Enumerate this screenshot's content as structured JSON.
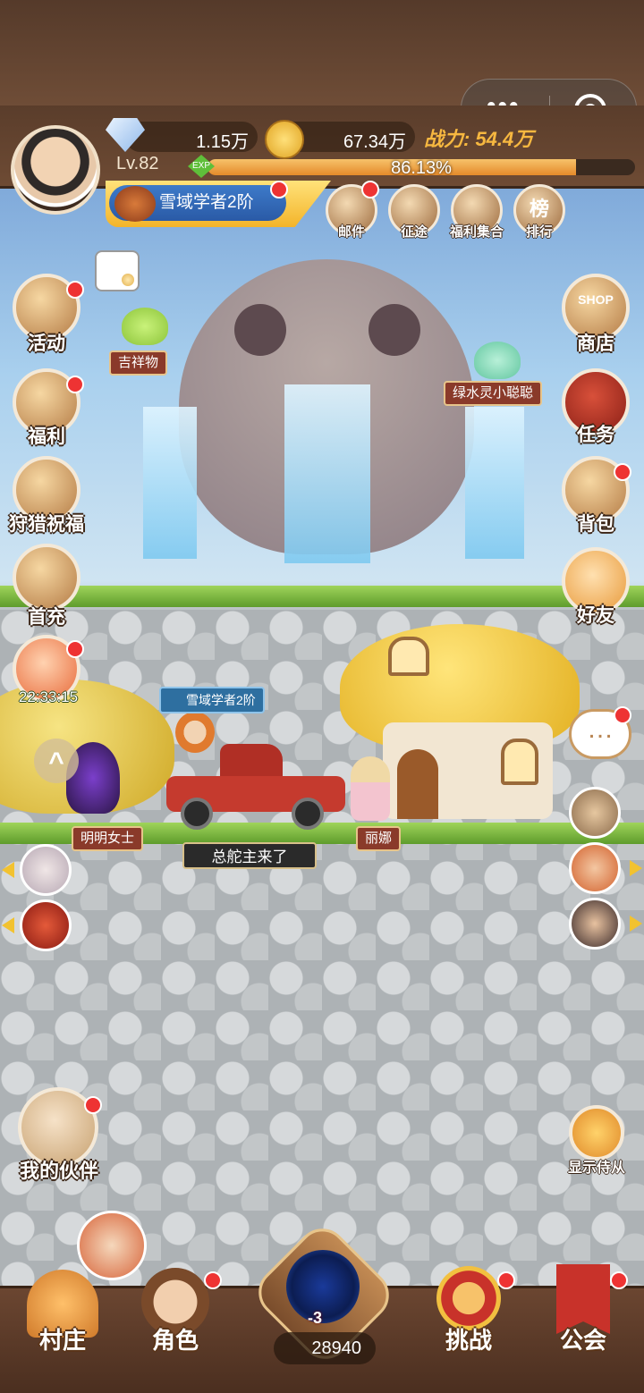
{
  "resources": {
    "diamonds": "1.15万",
    "gold": "67.34万"
  },
  "power": "战力: 54.4万",
  "player": {
    "level": "Lv.82",
    "exp_icon": "EXP",
    "exp_percent_text": "86.13%",
    "exp_fraction": 0.8613
  },
  "title_badge": "雪域学者2阶",
  "top_menu": [
    {
      "label": "邮件",
      "icon": "mail-icon"
    },
    {
      "label": "征途",
      "icon": "scroll-icon"
    },
    {
      "label": "福利集合",
      "icon": "treasure-chest-icon"
    },
    {
      "label": "排行",
      "icon": "ranking-icon",
      "glyph": "榜"
    }
  ],
  "left_menu": [
    {
      "label": "活动",
      "icon": "gift-box-icon"
    },
    {
      "label": "福利",
      "icon": "gift-icon"
    },
    {
      "label": "狩猎祝福",
      "icon": "meat-icon"
    },
    {
      "label": "首充",
      "icon": "treasure-icon"
    }
  ],
  "right_menu": [
    {
      "label": "商店",
      "icon": "shop-icon",
      "glyph": "SHOP"
    },
    {
      "label": "任务",
      "icon": "quest-book-icon"
    },
    {
      "label": "背包",
      "icon": "backpack-icon"
    },
    {
      "label": "好友",
      "icon": "mushroom-friend-icon"
    }
  ],
  "event_timer": "22:33:15",
  "npcs": {
    "mascot": "吉祥物",
    "green_slime": "绿水灵小聪聪",
    "lady_left": "明明女士",
    "lina": "丽娜"
  },
  "hero_title": "雪域学者2阶",
  "chat_message": "总舵主来了",
  "partner_label": "我的伙伴",
  "show_followers_label": "显示侍从",
  "bottom_nav": [
    {
      "label": "村庄",
      "icon": "village-icon"
    },
    {
      "label": "角色",
      "icon": "character-icon"
    },
    {
      "label": "挑战",
      "icon": "challenge-star-icon"
    },
    {
      "label": "公会",
      "icon": "guild-banner-icon"
    }
  ],
  "portal": {
    "cost": "-3",
    "food_count": "28940"
  },
  "colors": {
    "power": "#f7b840",
    "exp_fill": "#e58a2a",
    "badge": "#e33333"
  }
}
